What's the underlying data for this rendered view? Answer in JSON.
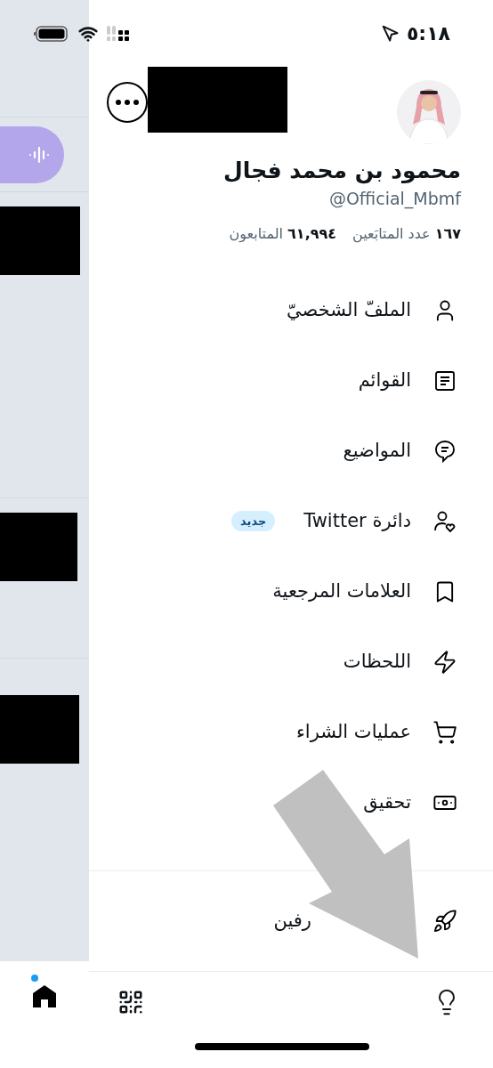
{
  "status_bar": {
    "time": "٥:١٨"
  },
  "profile": {
    "name": "محمود بن محمد فجال",
    "handle": "@Official_Mbmf",
    "stats": [
      {
        "count": "١٦٧",
        "label": "عدد المتابَعين"
      },
      {
        "count": "٦١,٩٩٤",
        "label": "المتابعون"
      }
    ]
  },
  "menu": [
    {
      "kind": "profile",
      "label": "الملفّ الشخصيّ"
    },
    {
      "kind": "lists",
      "label": "القوائم"
    },
    {
      "kind": "topics",
      "label": "المواضيع"
    },
    {
      "kind": "circle",
      "label": "دائرة Twitter",
      "badge": "جديد"
    },
    {
      "kind": "bookmarks",
      "label": "العلامات المرجعية"
    },
    {
      "kind": "moments",
      "label": "اللحظات"
    },
    {
      "kind": "purchases",
      "label": "عمليات الشراء"
    },
    {
      "kind": "monetization",
      "label": "تحقيق"
    }
  ],
  "professional": {
    "kind": "professional",
    "label": "رفين"
  },
  "bottom_bar": {
    "home_dot": true
  }
}
